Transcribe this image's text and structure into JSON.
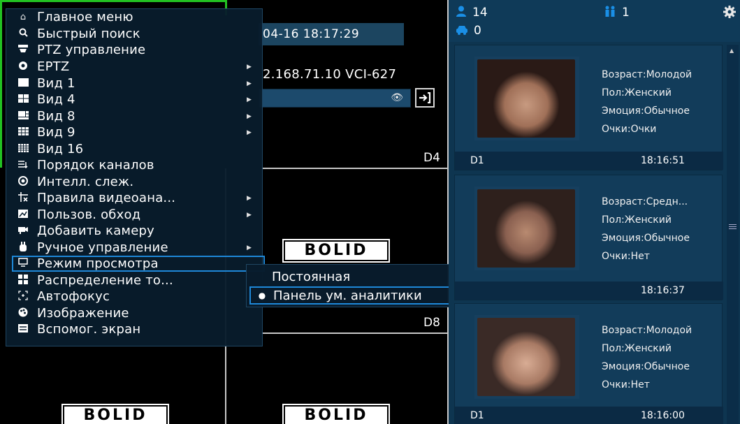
{
  "video": {
    "datetime": "04-16 18:17:29",
    "camera_name": "2.168.71.10 VCI-627",
    "channel_labels": {
      "d4": "D4",
      "d8": "D8"
    },
    "logo_text": "BOLID"
  },
  "menu": {
    "items": [
      {
        "label": "Главное меню",
        "icon": "home-icon",
        "arrow": false
      },
      {
        "label": "Быстрый поиск",
        "icon": "search-icon",
        "arrow": false
      },
      {
        "label": "PTZ управление",
        "icon": "ptz-icon",
        "arrow": false
      },
      {
        "label": "EPTZ",
        "icon": "eptz-icon",
        "arrow": true
      },
      {
        "label": "Вид 1",
        "icon": "view1-icon",
        "arrow": true
      },
      {
        "label": "Вид 4",
        "icon": "view4-icon",
        "arrow": true
      },
      {
        "label": "Вид 8",
        "icon": "view8-icon",
        "arrow": true
      },
      {
        "label": "Вид 9",
        "icon": "view9-icon",
        "arrow": true
      },
      {
        "label": "Вид 16",
        "icon": "view16-icon",
        "arrow": false
      },
      {
        "label": "Порядок каналов",
        "icon": "channel-order-icon",
        "arrow": false
      },
      {
        "label": "Интелл. слеж.",
        "icon": "tracking-icon",
        "arrow": false
      },
      {
        "label": "Правила видеоана...",
        "icon": "analytics-rules-icon",
        "arrow": true
      },
      {
        "label": "Пользов. обход",
        "icon": "patrol-icon",
        "arrow": true
      },
      {
        "label": "Добавить камеру",
        "icon": "add-camera-icon",
        "arrow": false
      },
      {
        "label": "Ручное управление",
        "icon": "manual-control-icon",
        "arrow": true
      },
      {
        "label": "Режим просмотра",
        "icon": "monitor-icon",
        "arrow": false
      },
      {
        "label": "Распределение то...",
        "icon": "stream-distribution-icon",
        "arrow": false
      },
      {
        "label": "Автофокус",
        "icon": "autofocus-icon",
        "arrow": false
      },
      {
        "label": "Изображение",
        "icon": "image-icon",
        "arrow": false
      },
      {
        "label": "Вспомог. экран",
        "icon": "aux-screen-icon",
        "arrow": false
      }
    ],
    "selected_index": 15
  },
  "submenu": {
    "items": [
      {
        "label": "Постоянная",
        "selected": false
      },
      {
        "label": "Панель ум. аналитики",
        "selected": true
      }
    ]
  },
  "panel": {
    "stats": {
      "people": "14",
      "groups": "1",
      "vehicles": "0"
    },
    "cards": [
      {
        "age": "Возраст:Молодой",
        "gender": "Пол:Женский",
        "emotion": "Эмоция:Обычное",
        "glasses": "Очки:Очки",
        "channel": "D1",
        "time": "18:16:51"
      },
      {
        "age": "Возраст:Средн...",
        "gender": "Пол:Женский",
        "emotion": "Эмоция:Обычное",
        "glasses": "Очки:Нет",
        "channel": "",
        "time": "18:16:37"
      },
      {
        "age": "Возраст:Молодой",
        "gender": "Пол:Женский",
        "emotion": "Эмоция:Обычное",
        "glasses": "Очки:Нет",
        "channel": "D1",
        "time": "18:16:00"
      }
    ]
  },
  "colors": {
    "accent": "#1e88d8",
    "panel_bg": "#0e3550",
    "menu_bg": "#081c2c"
  }
}
